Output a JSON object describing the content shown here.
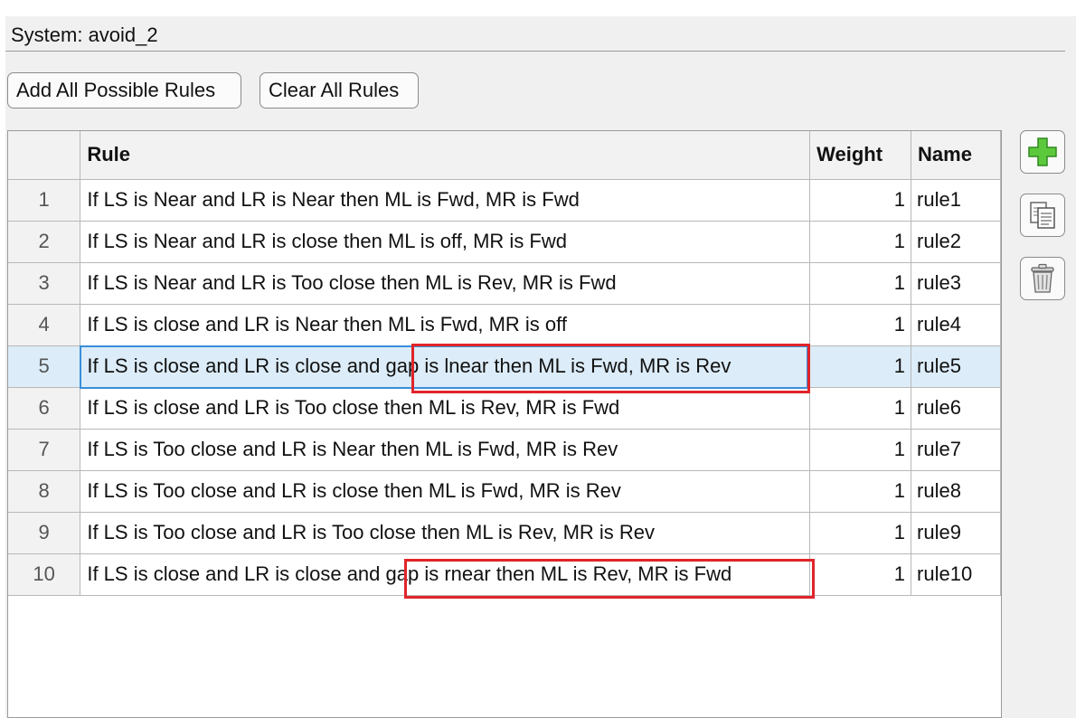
{
  "system": {
    "label": "System: avoid_2"
  },
  "toolbar": {
    "add_all_label": "Add All Possible Rules",
    "clear_all_label": "Clear All Rules"
  },
  "table": {
    "columns": {
      "index": "",
      "rule": "Rule",
      "weight": "Weight",
      "name": "Name"
    },
    "selected_row": 5,
    "rows": [
      {
        "index": "1",
        "rule": "If LS is Near and LR is Near then ML is Fwd, MR is Fwd",
        "weight": "1",
        "name": "rule1"
      },
      {
        "index": "2",
        "rule": "If LS is Near and LR is close then ML is off, MR is Fwd",
        "weight": "1",
        "name": "rule2"
      },
      {
        "index": "3",
        "rule": "If LS is Near and LR is Too close then ML is Rev, MR is Fwd",
        "weight": "1",
        "name": "rule3"
      },
      {
        "index": "4",
        "rule": "If LS is close and LR is Near then ML is Fwd, MR is off",
        "weight": "1",
        "name": "rule4"
      },
      {
        "index": "5",
        "rule": "If LS is close and LR is close and gap is lnear then ML is Fwd, MR is Rev",
        "weight": "1",
        "name": "rule5"
      },
      {
        "index": "6",
        "rule": "If LS is close and LR is Too close then ML is Rev, MR is Fwd",
        "weight": "1",
        "name": "rule6"
      },
      {
        "index": "7",
        "rule": "If LS is Too close and LR is Near then ML is Fwd, MR is Rev",
        "weight": "1",
        "name": "rule7"
      },
      {
        "index": "8",
        "rule": "If LS is Too close and LR is close then ML is Fwd, MR is Rev",
        "weight": "1",
        "name": "rule8"
      },
      {
        "index": "9",
        "rule": "If LS is Too close and LR is Too close then ML is Rev, MR is Rev",
        "weight": "1",
        "name": "rule9"
      },
      {
        "index": "10",
        "rule": "If LS is close and LR is close and gap is rnear then ML is Rev, MR is Fwd",
        "weight": "1",
        "name": "rule10"
      }
    ]
  },
  "side_buttons": [
    {
      "icon": "plus-icon"
    },
    {
      "icon": "copy-icon"
    },
    {
      "icon": "trash-icon"
    }
  ],
  "colors": {
    "selection": "#dcecf8",
    "focus_border": "#3a8ed8",
    "annotation_red": "#e0242b",
    "add_green": "#5cc93c"
  }
}
